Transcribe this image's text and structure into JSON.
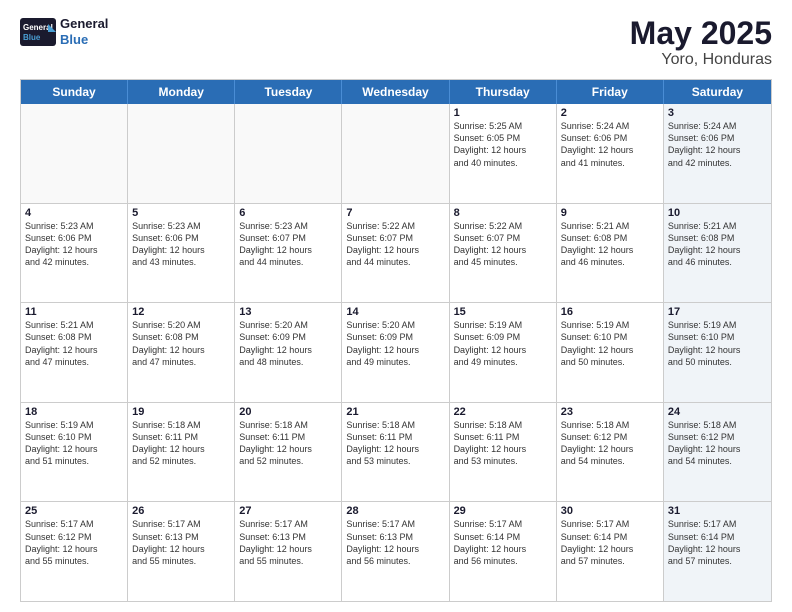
{
  "logo": {
    "line1": "General",
    "line2": "Blue"
  },
  "title": "May 2025",
  "location": "Yoro, Honduras",
  "days": [
    "Sunday",
    "Monday",
    "Tuesday",
    "Wednesday",
    "Thursday",
    "Friday",
    "Saturday"
  ],
  "weeks": [
    [
      {
        "day": "",
        "info": "",
        "empty": true
      },
      {
        "day": "",
        "info": "",
        "empty": true
      },
      {
        "day": "",
        "info": "",
        "empty": true
      },
      {
        "day": "",
        "info": "",
        "empty": true
      },
      {
        "day": "1",
        "info": "Sunrise: 5:25 AM\nSunset: 6:05 PM\nDaylight: 12 hours\nand 40 minutes.",
        "empty": false
      },
      {
        "day": "2",
        "info": "Sunrise: 5:24 AM\nSunset: 6:06 PM\nDaylight: 12 hours\nand 41 minutes.",
        "empty": false
      },
      {
        "day": "3",
        "info": "Sunrise: 5:24 AM\nSunset: 6:06 PM\nDaylight: 12 hours\nand 42 minutes.",
        "empty": false,
        "shaded": true
      }
    ],
    [
      {
        "day": "4",
        "info": "Sunrise: 5:23 AM\nSunset: 6:06 PM\nDaylight: 12 hours\nand 42 minutes.",
        "empty": false
      },
      {
        "day": "5",
        "info": "Sunrise: 5:23 AM\nSunset: 6:06 PM\nDaylight: 12 hours\nand 43 minutes.",
        "empty": false
      },
      {
        "day": "6",
        "info": "Sunrise: 5:23 AM\nSunset: 6:07 PM\nDaylight: 12 hours\nand 44 minutes.",
        "empty": false
      },
      {
        "day": "7",
        "info": "Sunrise: 5:22 AM\nSunset: 6:07 PM\nDaylight: 12 hours\nand 44 minutes.",
        "empty": false
      },
      {
        "day": "8",
        "info": "Sunrise: 5:22 AM\nSunset: 6:07 PM\nDaylight: 12 hours\nand 45 minutes.",
        "empty": false
      },
      {
        "day": "9",
        "info": "Sunrise: 5:21 AM\nSunset: 6:08 PM\nDaylight: 12 hours\nand 46 minutes.",
        "empty": false
      },
      {
        "day": "10",
        "info": "Sunrise: 5:21 AM\nSunset: 6:08 PM\nDaylight: 12 hours\nand 46 minutes.",
        "empty": false,
        "shaded": true
      }
    ],
    [
      {
        "day": "11",
        "info": "Sunrise: 5:21 AM\nSunset: 6:08 PM\nDaylight: 12 hours\nand 47 minutes.",
        "empty": false
      },
      {
        "day": "12",
        "info": "Sunrise: 5:20 AM\nSunset: 6:08 PM\nDaylight: 12 hours\nand 47 minutes.",
        "empty": false
      },
      {
        "day": "13",
        "info": "Sunrise: 5:20 AM\nSunset: 6:09 PM\nDaylight: 12 hours\nand 48 minutes.",
        "empty": false
      },
      {
        "day": "14",
        "info": "Sunrise: 5:20 AM\nSunset: 6:09 PM\nDaylight: 12 hours\nand 49 minutes.",
        "empty": false
      },
      {
        "day": "15",
        "info": "Sunrise: 5:19 AM\nSunset: 6:09 PM\nDaylight: 12 hours\nand 49 minutes.",
        "empty": false
      },
      {
        "day": "16",
        "info": "Sunrise: 5:19 AM\nSunset: 6:10 PM\nDaylight: 12 hours\nand 50 minutes.",
        "empty": false
      },
      {
        "day": "17",
        "info": "Sunrise: 5:19 AM\nSunset: 6:10 PM\nDaylight: 12 hours\nand 50 minutes.",
        "empty": false,
        "shaded": true
      }
    ],
    [
      {
        "day": "18",
        "info": "Sunrise: 5:19 AM\nSunset: 6:10 PM\nDaylight: 12 hours\nand 51 minutes.",
        "empty": false
      },
      {
        "day": "19",
        "info": "Sunrise: 5:18 AM\nSunset: 6:11 PM\nDaylight: 12 hours\nand 52 minutes.",
        "empty": false
      },
      {
        "day": "20",
        "info": "Sunrise: 5:18 AM\nSunset: 6:11 PM\nDaylight: 12 hours\nand 52 minutes.",
        "empty": false
      },
      {
        "day": "21",
        "info": "Sunrise: 5:18 AM\nSunset: 6:11 PM\nDaylight: 12 hours\nand 53 minutes.",
        "empty": false
      },
      {
        "day": "22",
        "info": "Sunrise: 5:18 AM\nSunset: 6:11 PM\nDaylight: 12 hours\nand 53 minutes.",
        "empty": false
      },
      {
        "day": "23",
        "info": "Sunrise: 5:18 AM\nSunset: 6:12 PM\nDaylight: 12 hours\nand 54 minutes.",
        "empty": false
      },
      {
        "day": "24",
        "info": "Sunrise: 5:18 AM\nSunset: 6:12 PM\nDaylight: 12 hours\nand 54 minutes.",
        "empty": false,
        "shaded": true
      }
    ],
    [
      {
        "day": "25",
        "info": "Sunrise: 5:17 AM\nSunset: 6:12 PM\nDaylight: 12 hours\nand 55 minutes.",
        "empty": false
      },
      {
        "day": "26",
        "info": "Sunrise: 5:17 AM\nSunset: 6:13 PM\nDaylight: 12 hours\nand 55 minutes.",
        "empty": false
      },
      {
        "day": "27",
        "info": "Sunrise: 5:17 AM\nSunset: 6:13 PM\nDaylight: 12 hours\nand 55 minutes.",
        "empty": false
      },
      {
        "day": "28",
        "info": "Sunrise: 5:17 AM\nSunset: 6:13 PM\nDaylight: 12 hours\nand 56 minutes.",
        "empty": false
      },
      {
        "day": "29",
        "info": "Sunrise: 5:17 AM\nSunset: 6:14 PM\nDaylight: 12 hours\nand 56 minutes.",
        "empty": false
      },
      {
        "day": "30",
        "info": "Sunrise: 5:17 AM\nSunset: 6:14 PM\nDaylight: 12 hours\nand 57 minutes.",
        "empty": false
      },
      {
        "day": "31",
        "info": "Sunrise: 5:17 AM\nSunset: 6:14 PM\nDaylight: 12 hours\nand 57 minutes.",
        "empty": false,
        "shaded": true
      }
    ]
  ]
}
